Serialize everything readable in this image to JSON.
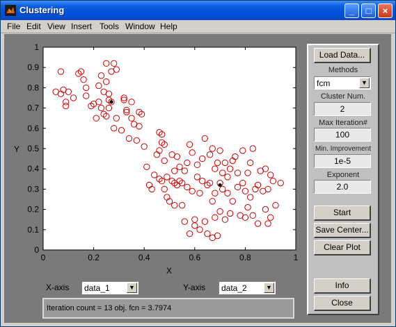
{
  "window": {
    "title": "Clustering",
    "min": "_",
    "max": "□",
    "close": "×"
  },
  "menu": [
    "File",
    "Edit",
    "View",
    "Insert",
    "Tools",
    "Window",
    "Help"
  ],
  "plot": {
    "xlabel": "X",
    "ylabel": "Y",
    "xticks": [
      "0",
      "0.2",
      "0.4",
      "0.6",
      "0.8",
      "1"
    ],
    "yticks": [
      "0",
      "0.1",
      "0.2",
      "0.3",
      "0.4",
      "0.5",
      "0.6",
      "0.7",
      "0.8",
      "0.9",
      "1"
    ]
  },
  "axes": {
    "x_label": "X-axis",
    "x_value": "data_1",
    "y_label": "Y-axis",
    "y_value": "data_2"
  },
  "status_text": "Iteration count = 13 obj. fcn = 3.7974",
  "panel": {
    "load_data": "Load Data...",
    "methods_label": "Methods",
    "methods_value": "fcm",
    "cluster_label": "Cluster Num.",
    "cluster_value": "2",
    "max_iter_label": "Max Iteration#",
    "max_iter_value": "100",
    "min_impr_label": "Min. Improvement",
    "min_impr_value": "1e-5",
    "exponent_label": "Exponent",
    "exponent_value": "2.0",
    "start": "Start",
    "save_center": "Save Center...",
    "clear_plot": "Clear Plot",
    "info": "Info",
    "close": "Close"
  },
  "chart_data": {
    "type": "scatter",
    "title": "",
    "xlabel": "X",
    "ylabel": "Y",
    "xlim": [
      0,
      1
    ],
    "ylim": [
      0,
      1
    ],
    "grid": false,
    "colors": {
      "points": "#cc0000",
      "centers": "#000000"
    },
    "series": [
      {
        "name": "",
        "marker": "circle-open",
        "x": [
          0.05,
          0.07,
          0.07,
          0.08,
          0.09,
          0.09,
          0.1,
          0.12,
          0.14,
          0.15,
          0.16,
          0.17,
          0.17,
          0.19,
          0.2,
          0.21,
          0.22,
          0.22,
          0.23,
          0.23,
          0.24,
          0.24,
          0.25,
          0.25,
          0.25,
          0.26,
          0.26,
          0.26,
          0.27,
          0.27,
          0.28,
          0.28,
          0.29,
          0.29,
          0.31,
          0.32,
          0.32,
          0.33,
          0.33,
          0.34,
          0.35,
          0.35,
          0.36,
          0.37,
          0.38,
          0.38,
          0.39,
          0.4,
          0.41,
          0.42,
          0.43,
          0.44,
          0.45,
          0.46,
          0.46,
          0.46,
          0.47,
          0.47,
          0.47,
          0.48,
          0.48,
          0.48,
          0.49,
          0.49,
          0.5,
          0.51,
          0.51,
          0.52,
          0.52,
          0.52,
          0.53,
          0.53,
          0.54,
          0.54,
          0.55,
          0.55,
          0.56,
          0.56,
          0.57,
          0.57,
          0.58,
          0.58,
          0.59,
          0.59,
          0.6,
          0.6,
          0.61,
          0.61,
          0.62,
          0.62,
          0.63,
          0.63,
          0.64,
          0.64,
          0.65,
          0.65,
          0.66,
          0.66,
          0.67,
          0.67,
          0.67,
          0.68,
          0.68,
          0.68,
          0.69,
          0.69,
          0.7,
          0.7,
          0.7,
          0.71,
          0.71,
          0.72,
          0.72,
          0.73,
          0.73,
          0.74,
          0.74,
          0.75,
          0.75,
          0.76,
          0.77,
          0.77,
          0.78,
          0.79,
          0.79,
          0.8,
          0.8,
          0.81,
          0.81,
          0.82,
          0.82,
          0.83,
          0.83,
          0.84,
          0.85,
          0.85,
          0.86,
          0.87,
          0.88,
          0.88,
          0.89,
          0.89,
          0.9,
          0.9,
          0.91,
          0.92,
          0.94
        ],
        "y": [
          0.78,
          0.88,
          0.77,
          0.79,
          0.73,
          0.71,
          0.78,
          0.75,
          0.87,
          0.88,
          0.84,
          0.8,
          0.76,
          0.71,
          0.72,
          0.65,
          0.81,
          0.73,
          0.86,
          0.7,
          0.67,
          0.78,
          0.83,
          0.92,
          0.66,
          0.77,
          0.7,
          0.74,
          0.73,
          0.88,
          0.92,
          0.6,
          0.65,
          0.89,
          0.59,
          0.75,
          0.74,
          0.69,
          0.68,
          0.55,
          0.65,
          0.73,
          0.62,
          0.54,
          0.68,
          0.61,
          0.67,
          0.51,
          0.41,
          0.32,
          0.3,
          0.37,
          0.47,
          0.49,
          0.58,
          0.35,
          0.34,
          0.57,
          0.53,
          0.52,
          0.44,
          0.3,
          0.26,
          0.36,
          0.24,
          0.34,
          0.47,
          0.33,
          0.39,
          0.22,
          0.32,
          0.46,
          0.41,
          0.34,
          0.22,
          0.33,
          0.39,
          0.14,
          0.43,
          0.31,
          0.52,
          0.08,
          0.29,
          0.48,
          0.12,
          0.15,
          0.36,
          0.42,
          0.28,
          0.1,
          0.45,
          0.34,
          0.55,
          0.14,
          0.32,
          0.08,
          0.33,
          0.47,
          0.24,
          0.5,
          0.06,
          0.28,
          0.4,
          0.16,
          0.43,
          0.07,
          0.49,
          0.19,
          0.33,
          0.38,
          0.3,
          0.43,
          0.15,
          0.28,
          0.36,
          0.18,
          0.4,
          0.24,
          0.44,
          0.46,
          0.31,
          0.38,
          0.17,
          0.49,
          0.33,
          0.16,
          0.29,
          0.38,
          0.21,
          0.26,
          0.43,
          0.5,
          0.17,
          0.3,
          0.32,
          0.13,
          0.39,
          0.29,
          0.2,
          0.4,
          0.13,
          0.3,
          0.37,
          0.16,
          0.34,
          0.22,
          0.33
        ]
      },
      {
        "name": "",
        "marker": "dot",
        "x": [
          0.27,
          0.7
        ],
        "y": [
          0.73,
          0.32
        ]
      }
    ]
  }
}
